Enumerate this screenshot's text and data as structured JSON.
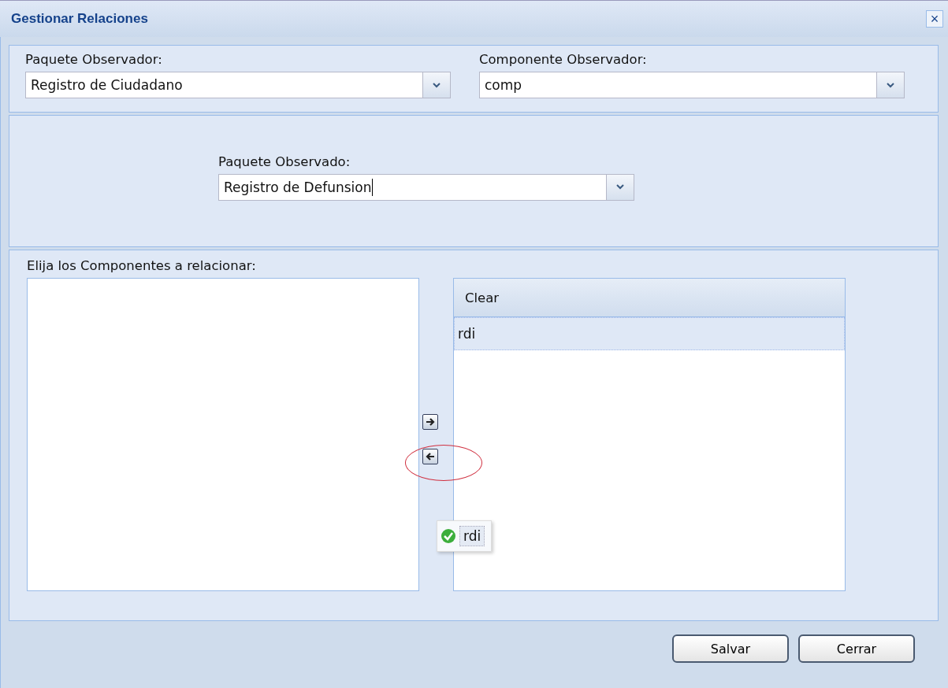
{
  "window": {
    "title": "Gestionar Relaciones",
    "close": "×"
  },
  "observer_panel": {
    "fields": [
      {
        "label": "Paquete Observador:",
        "value": "Registro de Ciudadano"
      },
      {
        "label": "Componente Observador:",
        "value": "comp"
      }
    ]
  },
  "observed_panel": {
    "field": {
      "label": "Paquete Observado:",
      "value": "Registro de Defunsion",
      "focused": true
    }
  },
  "components_panel": {
    "label": "Elija los Componentes a relacionar:",
    "selected_grid": {
      "header": "Clear",
      "rows": [
        {
          "text": "rdi",
          "selected": true
        }
      ]
    },
    "drag_proxy": {
      "text": "rdi",
      "valid": true
    }
  },
  "buttons": [
    "Salvar",
    "Cerrar"
  ]
}
